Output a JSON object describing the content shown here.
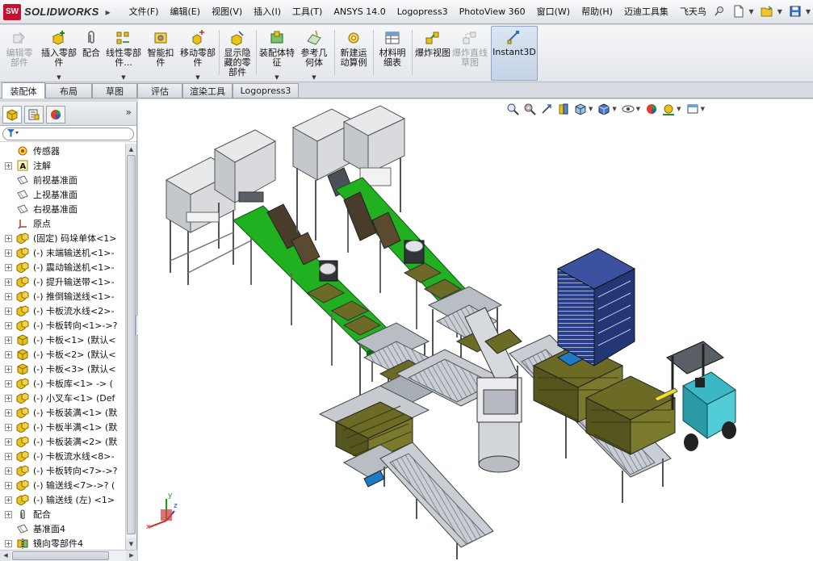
{
  "app": {
    "logo_badge": "SW",
    "logo_text": "SOLIDWORKS"
  },
  "menu": {
    "items": [
      "文件(F)",
      "编辑(E)",
      "视图(V)",
      "插入(I)",
      "工具(T)",
      "ANSYS 14.0",
      "Logopress3",
      "PhotoView 360",
      "窗口(W)",
      "帮助(H)",
      "迈迪工具集",
      "飞天鸟"
    ]
  },
  "ribbon": {
    "edit_component": "编辑零部件",
    "insert_components": "插入零部件",
    "mate": "配合",
    "linear_pattern": "线性零部件...",
    "smart_fasteners": "智能扣件",
    "move_component": "移动零部件",
    "show_hidden": "显示隐藏的零部件",
    "assembly_features": "装配体特征",
    "reference_geometry": "参考几何体",
    "new_motion_study": "新建运动算例",
    "bom": "材料明细表",
    "exploded_view": "爆炸视图",
    "explode_line_sketch": "爆炸直线草图",
    "instant3d": "Instant3D"
  },
  "tabs": [
    "装配体",
    "布局",
    "草图",
    "评估",
    "渲染工具",
    "Logopress3"
  ],
  "tree": {
    "items": [
      {
        "label": "传感器",
        "icon": "sensor-icon",
        "expand": false
      },
      {
        "label": "注解",
        "icon": "annotation-icon",
        "expand": true
      },
      {
        "label": "前视基准面",
        "icon": "plane-icon",
        "expand": false
      },
      {
        "label": "上视基准面",
        "icon": "plane-icon",
        "expand": false
      },
      {
        "label": "右视基准面",
        "icon": "plane-icon",
        "expand": false
      },
      {
        "label": "原点",
        "icon": "origin-icon",
        "expand": false
      },
      {
        "label": "(固定) 码垛单体<1>",
        "icon": "assembly-icon",
        "expand": true
      },
      {
        "label": "(-) 末端输送机<1>-",
        "icon": "assembly-icon",
        "expand": true
      },
      {
        "label": "(-) 震动输送机<1>-",
        "icon": "assembly-icon",
        "expand": true
      },
      {
        "label": "(-) 提升输送带<1>-",
        "icon": "assembly-icon",
        "expand": true
      },
      {
        "label": "(-) 推倒输送线<1>-",
        "icon": "assembly-icon",
        "expand": true
      },
      {
        "label": "(-) 卡板流水线<2>-",
        "icon": "assembly-icon",
        "expand": true
      },
      {
        "label": "(-) 卡板转向<1>->?",
        "icon": "assembly-icon",
        "expand": true
      },
      {
        "label": "(-) 卡板<1> (默认<",
        "icon": "part-icon",
        "expand": true
      },
      {
        "label": "(-) 卡板<2> (默认<",
        "icon": "part-icon",
        "expand": true
      },
      {
        "label": "(-) 卡板<3> (默认<",
        "icon": "part-icon",
        "expand": true
      },
      {
        "label": "(-) 卡板库<1> -> (",
        "icon": "assembly-icon",
        "expand": true
      },
      {
        "label": "(-) 小叉车<1> (Def",
        "icon": "assembly-icon",
        "expand": true
      },
      {
        "label": "(-) 卡板装满<1> (默",
        "icon": "assembly-icon",
        "expand": true
      },
      {
        "label": "(-) 卡板半满<1> (默",
        "icon": "assembly-icon",
        "expand": true
      },
      {
        "label": "(-) 卡板装满<2> (默",
        "icon": "assembly-icon",
        "expand": true
      },
      {
        "label": "(-) 卡板流水线<8>-",
        "icon": "assembly-icon",
        "expand": true
      },
      {
        "label": "(-) 卡板转向<7>->?",
        "icon": "assembly-icon",
        "expand": true
      },
      {
        "label": "(-) 输送线<7>->? (",
        "icon": "assembly-icon",
        "expand": true
      },
      {
        "label": "(-) 输送线 (左) <1>",
        "icon": "assembly-icon",
        "expand": true
      },
      {
        "label": "配合",
        "icon": "mates-icon",
        "expand": true
      },
      {
        "label": "基准面4",
        "icon": "plane-icon",
        "expand": false
      },
      {
        "label": "镜向零部件4",
        "icon": "mirror-icon",
        "expand": true
      }
    ]
  },
  "colors": {
    "accent": "#1860b8",
    "component_yellow": "#e9c21a",
    "conveyor_green": "#20b020",
    "frame_gray": "#8e949c",
    "box_olive": "#6b6b25",
    "forklift_cyan": "#3cb8c4",
    "rack_navy": "#2a3f8a"
  },
  "triad": {
    "x": "x",
    "y": "y",
    "z": "z"
  }
}
